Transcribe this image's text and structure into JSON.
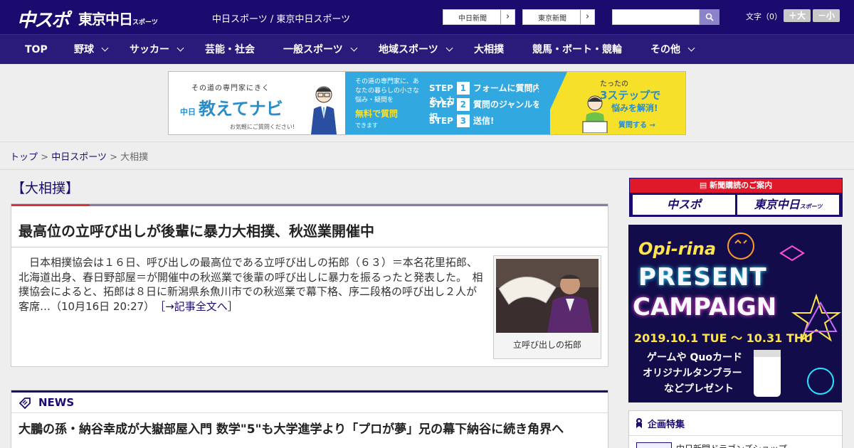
{
  "header": {
    "logo_chuspo": "中スポ",
    "logo_tokyo": "東京中日",
    "logo_tokyo_small": "スポーツ",
    "site_links": "中日スポーツ / 東京中日スポーツ",
    "paper_buttons": [
      "中日新聞",
      "東京新聞"
    ],
    "search_placeholder": "",
    "font_size_label": "文字（0）",
    "font_plus": "＋大",
    "font_minus": "－小"
  },
  "nav": {
    "items": [
      {
        "label": "TOP"
      },
      {
        "label": "野球"
      },
      {
        "label": "サッカー"
      },
      {
        "label": "芸能・社会"
      },
      {
        "label": "一般スポーツ"
      },
      {
        "label": "地域スポーツ"
      },
      {
        "label": "大相撲"
      },
      {
        "label": "競馬・ボート・競輪"
      },
      {
        "label": "その他"
      }
    ]
  },
  "banner": {
    "tag": "その道の専門家にきく",
    "title": "教えてナビ",
    "brand_small": "中日",
    "note": "お気軽にご質問ください!",
    "desc": "その道の専門家に、あなたの暮らしの小さな悩み・疑問を",
    "free": "無料で質問",
    "desc2": "できます",
    "steps": [
      {
        "label": "STEP",
        "num": "1",
        "text": "フォームに質問内容を入力"
      },
      {
        "label": "STEP",
        "num": "2",
        "text": "質問のジャンルを選択"
      },
      {
        "label": "STEP",
        "num": "3",
        "text": "送信!"
      }
    ],
    "r1": "たったの",
    "r2": "3ステップで",
    "r3": "悩みを解消!",
    "r4": "質問する →"
  },
  "breadcrumb": {
    "home": "トップ",
    "sep": ">",
    "section": "中日スポーツ",
    "current": "大相撲"
  },
  "main": {
    "category_heading": "【大相撲】",
    "article": {
      "title": "最高位の立呼び出しが後輩に暴力大相撲、秋巡業開催中",
      "body": "　日本相撲協会は１６日、呼び出しの最高位である立呼び出しの拓郎（６３）＝本名花里拓郎、北海道出身、春日野部屋＝が開催中の秋巡業で後輩の呼び出しに暴力を振るったと発表した。　相撲協会によると、拓郎は８日に新潟県糸魚川市での秋巡業で幕下格、序二段格の呼び出し２人が客席…（10月16日 20:27）",
      "read_more": "［→記事全文へ］",
      "photo_caption": "立呼び出しの拓郎"
    },
    "news": {
      "heading": "NEWS",
      "headline": "大鵬の孫・納谷幸成が大嶽部屋入門 数学\"5\"も大学進学より「プロが夢」兄の幕下納谷に続き角界へ"
    }
  },
  "sidebar": {
    "subscribe_heading": "新聞購読のご案内",
    "subscribe_logos": [
      "中スポ",
      "東京中日"
    ],
    "subscribe_logo_small": "スポーツ",
    "promo": {
      "brand": "Opi-rina",
      "line1": "PRESENT",
      "line2": "CAMPAIGN",
      "dates": "2019.10.1 TUE 〜 10.31 THU",
      "l1": "ゲームや Quoカード",
      "l2": "オリジナルタンブラー",
      "l3": "などプレゼント"
    },
    "feature_heading": "企画特集",
    "feature_item": "中日新聞ドラゴンズショップ"
  },
  "colors": {
    "header_bg": "#1c0b6e",
    "nav_bg": "#2a1a7a",
    "accent_red": "#d8333a",
    "link": "#1c0b6e"
  }
}
